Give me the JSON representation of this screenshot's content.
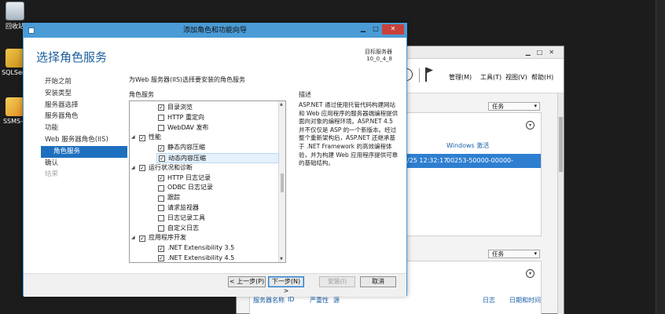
{
  "desktop": {
    "icons": [
      {
        "label": "回收站",
        "icon": "recycle-bin-icon"
      },
      {
        "label": "SQLServ",
        "icon": "sql-server-icon"
      },
      {
        "label": "SSMS-S",
        "icon": "ssms-icon"
      }
    ]
  },
  "background_window": {
    "menu": {
      "manage": "管理(M)",
      "tools": "工具(T)",
      "view": "视图(V)",
      "help": "帮助(H)"
    },
    "tasks_label": "任务",
    "panel1": {
      "col_windows_activation": "Windows 激活",
      "row_time": "/25 12:32:17",
      "row_id": "00253-50000-00000-AA442(已激活"
    },
    "panel2": {
      "columns": [
        "服务器名称",
        "ID",
        "严重性",
        "源",
        "日志",
        "日期和时间"
      ]
    }
  },
  "wizard": {
    "title": "添加角色和功能向导",
    "heading": "选择角色服务",
    "target_label": "目标服务器",
    "target_value": "10_0_4_8",
    "nav": [
      {
        "label": "开始之前",
        "state": "normal"
      },
      {
        "label": "安装类型",
        "state": "normal"
      },
      {
        "label": "服务器选择",
        "state": "normal"
      },
      {
        "label": "服务器角色",
        "state": "normal"
      },
      {
        "label": "功能",
        "state": "normal"
      },
      {
        "label": "Web 服务器角色(IIS)",
        "state": "normal"
      },
      {
        "label": "角色服务",
        "state": "active"
      },
      {
        "label": "确认",
        "state": "normal"
      },
      {
        "label": "结果",
        "state": "disabled"
      }
    ],
    "intro": "为Web 服务器(IIS)选择要安装的角色服务",
    "roles_label": "角色服务",
    "tree": [
      {
        "label": "目录浏览",
        "level": 2,
        "checked": true,
        "expander": ""
      },
      {
        "label": "HTTP 重定向",
        "level": 2,
        "checked": false,
        "expander": ""
      },
      {
        "label": "WebDAV 发布",
        "level": 2,
        "checked": false,
        "expander": ""
      },
      {
        "label": "性能",
        "level": 1,
        "checked": true,
        "expander": "▲"
      },
      {
        "label": "静态内容压缩",
        "level": 2,
        "checked": true,
        "expander": ""
      },
      {
        "label": "动态内容压缩",
        "level": 2,
        "checked": true,
        "expander": "",
        "highlight": true
      },
      {
        "label": "运行状况和诊断",
        "level": 1,
        "checked": true,
        "expander": "▲"
      },
      {
        "label": "HTTP 日志记录",
        "level": 2,
        "checked": true,
        "expander": ""
      },
      {
        "label": "ODBC 日志记录",
        "level": 2,
        "checked": false,
        "expander": ""
      },
      {
        "label": "跟踪",
        "level": 2,
        "checked": false,
        "expander": ""
      },
      {
        "label": "请求监视器",
        "level": 2,
        "checked": false,
        "expander": ""
      },
      {
        "label": "日志记录工具",
        "level": 2,
        "checked": false,
        "expander": ""
      },
      {
        "label": "自定义日志",
        "level": 2,
        "checked": false,
        "expander": ""
      },
      {
        "label": "应用程序开发",
        "level": 1,
        "checked": true,
        "expander": "▲"
      },
      {
        "label": ".NET Extensibility 3.5",
        "level": 2,
        "checked": true,
        "expander": ""
      },
      {
        "label": ".NET Extensibility 4.5",
        "level": 2,
        "checked": true,
        "expander": ""
      }
    ],
    "description_title": "描述",
    "description": "ASP.NET 通过使用托管代码构建网站和 Web 应用程序的服务器端编程提供面向对象的编程环境。ASP.NET 4.5 并不仅仅是 ASP 的一个新版本。经过整个重新架构后，ASP.NET 还继承基于 .NET Framework 的高效编程体验，并为构建 Web 应用程序提供可靠的基础结构。",
    "buttons": {
      "prev": "< 上一步(P)",
      "next": "下一步(N) >",
      "install": "安装(I)",
      "cancel": "取消"
    }
  }
}
